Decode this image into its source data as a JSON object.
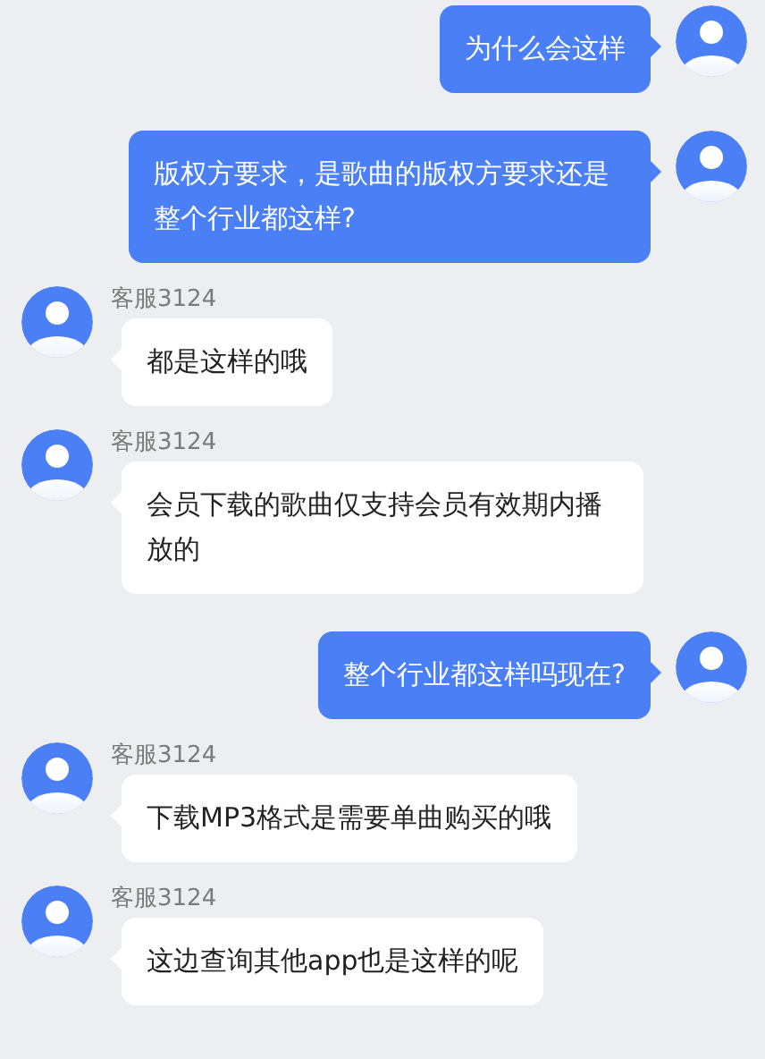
{
  "messages": [
    {
      "kind": "sent",
      "text": "为什么会这样"
    },
    {
      "kind": "sent",
      "text": "版权方要求，是歌曲的版权方要求还是整个行业都这样?"
    },
    {
      "kind": "received",
      "sender": "客服3124",
      "text": "都是这样的哦"
    },
    {
      "kind": "received",
      "sender": "客服3124",
      "text": "会员下载的歌曲仅支持会员有效期内播放的"
    },
    {
      "kind": "sent",
      "text": "整个行业都这样吗现在?"
    },
    {
      "kind": "received",
      "sender": "客服3124",
      "text": "下载MP3格式是需要单曲购买的哦"
    },
    {
      "kind": "received",
      "sender": "客服3124",
      "text": "这边查询其他app也是这样的呢"
    }
  ]
}
